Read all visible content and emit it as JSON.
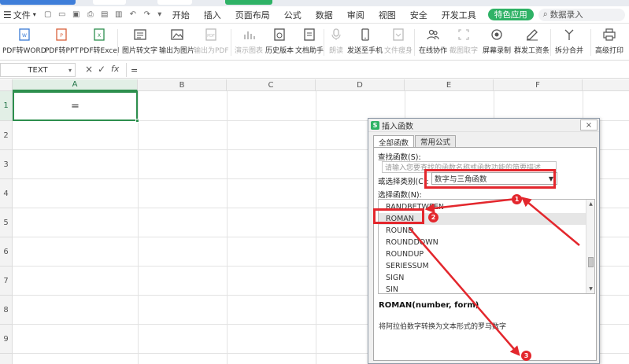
{
  "menubar": {
    "file": "文件",
    "items": [
      "开始",
      "插入",
      "页面布局",
      "公式",
      "数据",
      "审阅",
      "视图",
      "安全",
      "开发工具"
    ],
    "special": "特色应用",
    "search": "数据录入"
  },
  "ribbon": {
    "buttons": [
      {
        "label": "PDF转WORD",
        "icon": "pdf-word-icon"
      },
      {
        "label": "PDF转PPT",
        "icon": "pdf-ppt-icon"
      },
      {
        "label": "PDF转Excel",
        "icon": "pdf-excel-icon"
      },
      {
        "label": "图片转文字",
        "icon": "image-text-icon"
      },
      {
        "label": "输出为图片",
        "icon": "export-image-icon"
      },
      {
        "label": "输出为PDF",
        "icon": "export-pdf-icon"
      },
      {
        "label": "演示图表",
        "icon": "chart-icon"
      },
      {
        "label": "历史版本",
        "icon": "history-icon"
      },
      {
        "label": "文档助手",
        "icon": "assistant-icon"
      },
      {
        "label": "朗读",
        "icon": "read-aloud-icon"
      },
      {
        "label": "发送至手机",
        "icon": "phone-icon"
      },
      {
        "label": "文件瘦身",
        "icon": "compress-icon"
      },
      {
        "label": "在线协作",
        "icon": "collab-icon"
      },
      {
        "label": "截图取字",
        "icon": "ocr-icon"
      },
      {
        "label": "屏幕录制",
        "icon": "record-icon"
      },
      {
        "label": "群发工资条",
        "icon": "payslip-icon"
      },
      {
        "label": "拆分合并",
        "icon": "split-icon"
      },
      {
        "label": "高级打印",
        "icon": "print-icon"
      }
    ]
  },
  "formula_bar": {
    "name_box": "TEXT",
    "cancel": "×",
    "confirm": "✓",
    "fx": "fx",
    "content": "="
  },
  "sheet": {
    "columns": [
      "A",
      "B",
      "C",
      "D",
      "E",
      "F"
    ],
    "rows": [
      "1",
      "2",
      "3",
      "4",
      "5",
      "6",
      "7",
      "8",
      "9"
    ],
    "active_cell_value": "="
  },
  "dialog": {
    "title": "插入函数",
    "close": "×",
    "tabs": [
      "全部函数",
      "常用公式"
    ],
    "search_label": "查找函数(S):",
    "search_placeholder": "请输入您要查找的函数名称或函数功能的简要描述",
    "category_label": "或选择类别(C):",
    "category_value": "数字与三角函数",
    "list_label": "选择函数(N):",
    "functions": [
      "RANDBETWEEN",
      "ROMAN",
      "ROUND",
      "ROUNDDOWN",
      "ROUNDUP",
      "SERIESSUM",
      "SIGN",
      "SIN"
    ],
    "selected_function": "ROMAN",
    "signature": "ROMAN(number, form)",
    "description": "将阿拉伯数字转换为文本形式的罗马数字"
  },
  "annotations": {
    "badges": [
      "1",
      "2",
      "3"
    ],
    "color": "#e3272d"
  },
  "colors": {
    "accent_green": "#2d8f4e",
    "special_green": "#2fb266"
  }
}
